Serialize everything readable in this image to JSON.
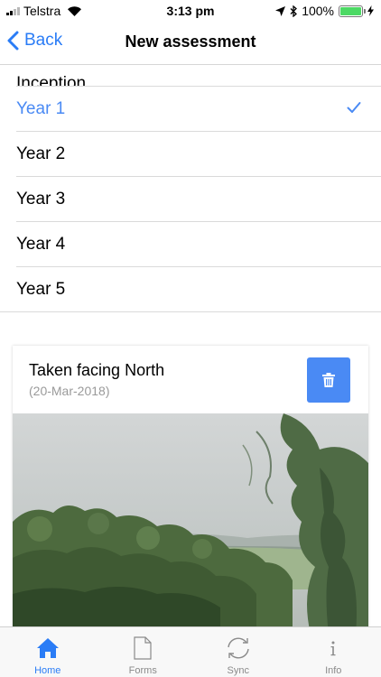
{
  "status_bar": {
    "carrier": "Telstra",
    "time": "3:13 pm",
    "battery": "100%",
    "battery_level": 1.0
  },
  "nav": {
    "back_label": "Back",
    "title": "New assessment"
  },
  "list": {
    "items": [
      {
        "label": "Inception",
        "selected": false
      },
      {
        "label": "Year 1",
        "selected": true
      },
      {
        "label": "Year 2",
        "selected": false
      },
      {
        "label": "Year 3",
        "selected": false
      },
      {
        "label": "Year 4",
        "selected": false
      },
      {
        "label": "Year 5",
        "selected": false
      }
    ]
  },
  "photo_card": {
    "title": "Taken facing North",
    "date": "(20-Mar-2018)",
    "delete_icon": "trash-icon"
  },
  "tabs": [
    {
      "label": "Home",
      "icon": "home-icon",
      "active": true
    },
    {
      "label": "Forms",
      "icon": "document-icon",
      "active": false
    },
    {
      "label": "Sync",
      "icon": "sync-icon",
      "active": false
    },
    {
      "label": "Info",
      "icon": "info-icon",
      "active": false
    }
  ],
  "colors": {
    "accent": "#2a7cf6",
    "selected_text": "#4a8af4",
    "delete_button": "#4a8af4",
    "battery": "#4cd964"
  }
}
